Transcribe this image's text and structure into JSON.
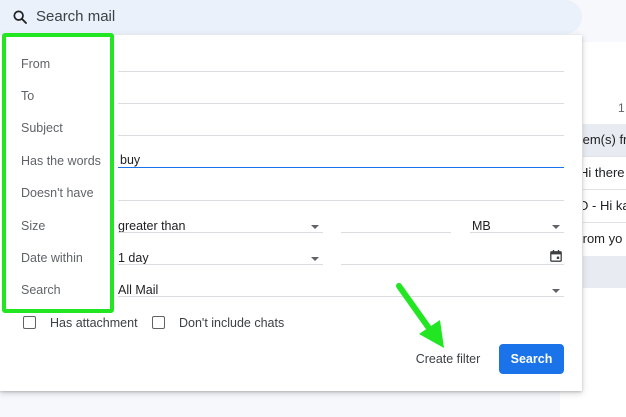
{
  "search": {
    "label": "Search mail"
  },
  "background": {
    "count_fragment": "1",
    "rows": [
      {
        "text": "tem(s) fr",
        "shaded": true
      },
      {
        "text": "Hi there",
        "shaded": false
      },
      {
        "text": "D - Hi kar",
        "shaded": false
      },
      {
        "text": "from yo",
        "shaded": false
      },
      {
        "text": "",
        "shaded": true
      }
    ]
  },
  "filter": {
    "labels": {
      "from": "From",
      "to": "To",
      "subject": "Subject",
      "has_words": "Has the words",
      "doesnt_have": "Doesn't have",
      "size": "Size",
      "date_within": "Date within",
      "search": "Search"
    },
    "values": {
      "has_words": "buy",
      "size_operator": "greater than",
      "size_unit": "MB",
      "date_within": "1 day",
      "search_scope": "All Mail"
    },
    "checkboxes": {
      "has_attachment": "Has attachment",
      "dont_include_chats": "Don't include chats"
    },
    "buttons": {
      "create_filter": "Create filter",
      "search": "Search"
    }
  },
  "colors": {
    "accent": "#1a73e8",
    "highlight": "#22e622",
    "searchbar": "#eaf1fb"
  }
}
